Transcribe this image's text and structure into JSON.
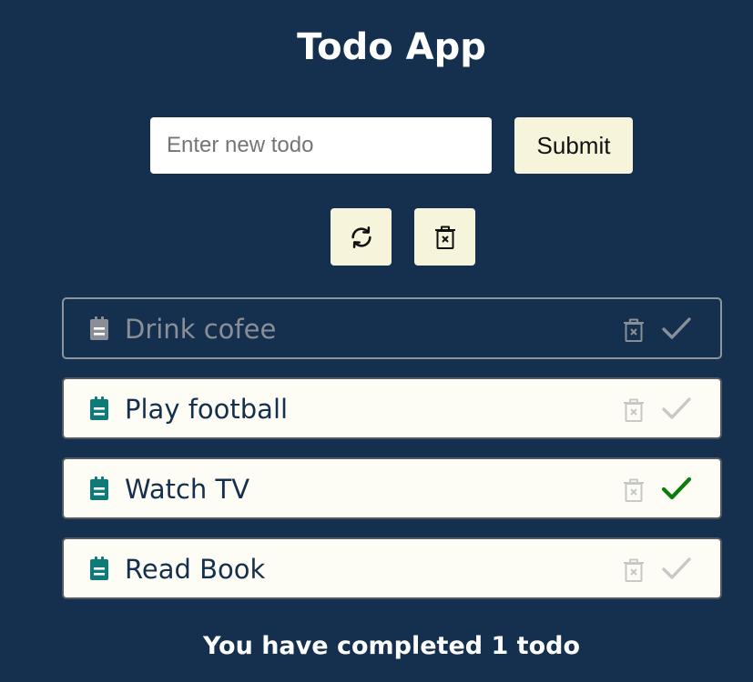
{
  "app": {
    "title": "Todo App"
  },
  "form": {
    "placeholder": "Enter new todo",
    "value": "",
    "submit_label": "Submit"
  },
  "toolbar": {
    "refresh_icon": "refresh-icon",
    "clear_icon": "trash-x-icon"
  },
  "todos": [
    {
      "text": "Drink cofee",
      "completed": true,
      "checked": false
    },
    {
      "text": "Play football",
      "completed": false,
      "checked": false
    },
    {
      "text": "Watch TV",
      "completed": false,
      "checked": true
    },
    {
      "text": "Read Book",
      "completed": false,
      "checked": false
    }
  ],
  "footer": {
    "summary": "You have completed 1 todo"
  },
  "colors": {
    "background": "#14304e",
    "button_bg": "#f7f4dc",
    "note_icon": "#0e7b78",
    "note_icon_done": "#8a8f97",
    "check_active": "#0a7d0a",
    "check_inactive": "#c8c8c8"
  }
}
